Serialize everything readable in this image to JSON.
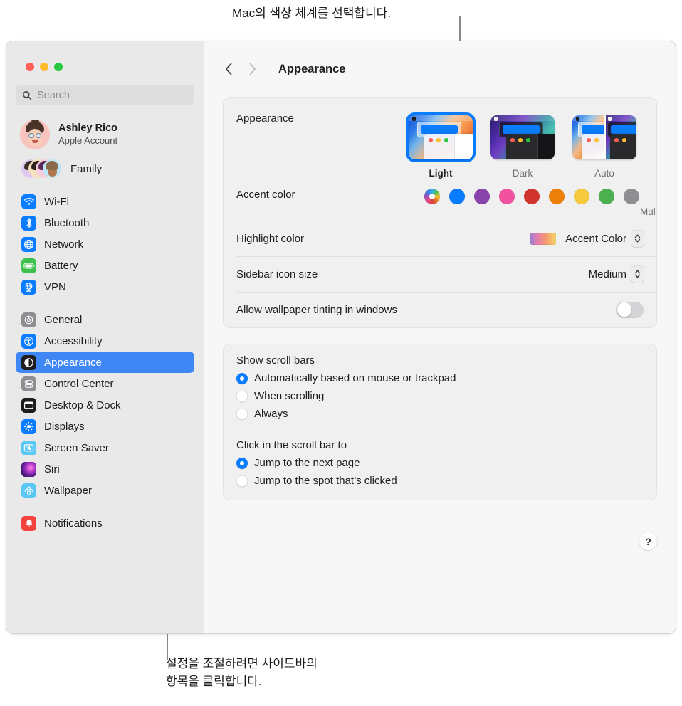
{
  "callouts": {
    "top": "Mac의 색상 체계를 선택합니다.",
    "bottom_line1": "설정을 조절하려면 사이드바의",
    "bottom_line2": "항목을 클릭합니다."
  },
  "window": {
    "traffic_lights": [
      "close-red",
      "minimize-yellow",
      "zoom-green"
    ],
    "toolbar": {
      "back_icon": "chevron-left-icon",
      "forward_icon": "chevron-right-icon",
      "title": "Appearance"
    }
  },
  "sidebar": {
    "search": {
      "placeholder": "Search",
      "value": "",
      "icon": "search-icon"
    },
    "account": {
      "name": "Ashley Rico",
      "subtitle": "Apple Account",
      "avatar": "memoji-avatar"
    },
    "family": {
      "label": "Family",
      "avatars": 4
    },
    "groups": [
      {
        "items": [
          {
            "label": "Wi-Fi",
            "icon": "wifi-icon",
            "color": "#0a7cff",
            "selected": false
          },
          {
            "label": "Bluetooth",
            "icon": "bluetooth-icon",
            "color": "#0a7cff",
            "selected": false
          },
          {
            "label": "Network",
            "icon": "globe-icon",
            "color": "#0a7cff",
            "selected": false
          },
          {
            "label": "Battery",
            "icon": "battery-icon",
            "color": "#3ec04e",
            "selected": false
          },
          {
            "label": "VPN",
            "icon": "vpn-globe-icon",
            "color": "#0a7cff",
            "selected": false
          }
        ]
      },
      {
        "items": [
          {
            "label": "General",
            "icon": "gear-icon",
            "color": "#8e8e93",
            "selected": false
          },
          {
            "label": "Accessibility",
            "icon": "accessibility-icon",
            "color": "#0a7cff",
            "selected": false
          },
          {
            "label": "Appearance",
            "icon": "appearance-contrast-icon",
            "color": "#1d1d1f",
            "selected": true
          },
          {
            "label": "Control Center",
            "icon": "control-center-icon",
            "color": "#8e8e93",
            "selected": false
          },
          {
            "label": "Desktop & Dock",
            "icon": "desktop-dock-icon",
            "color": "#1d1d1f",
            "selected": false
          },
          {
            "label": "Displays",
            "icon": "brightness-icon",
            "color": "#0a7cff",
            "selected": false
          },
          {
            "label": "Screen Saver",
            "icon": "screensaver-icon",
            "color": "#5ac8f5",
            "selected": false
          },
          {
            "label": "Siri",
            "icon": "siri-icon",
            "color": "#2a1040",
            "selected": false
          },
          {
            "label": "Wallpaper",
            "icon": "wallpaper-flower-icon",
            "color": "#5ac8f5",
            "selected": false
          }
        ]
      },
      {
        "items": [
          {
            "label": "Notifications",
            "icon": "bell-icon",
            "color": "#f4433c",
            "selected": false
          }
        ]
      }
    ]
  },
  "main": {
    "appearance": {
      "label": "Appearance",
      "options": [
        {
          "label": "Light",
          "selected": true
        },
        {
          "label": "Dark",
          "selected": false
        },
        {
          "label": "Auto",
          "selected": false
        }
      ]
    },
    "accent_color": {
      "label": "Accent color",
      "selected_name": "Multicolor",
      "swatches": [
        {
          "name": "Multicolor",
          "color": "multicolor",
          "selected": true
        },
        {
          "name": "Blue",
          "color": "#0a7cff",
          "selected": false
        },
        {
          "name": "Purple",
          "color": "#8944ab",
          "selected": false
        },
        {
          "name": "Pink",
          "color": "#f2519f",
          "selected": false
        },
        {
          "name": "Red",
          "color": "#d0342c",
          "selected": false
        },
        {
          "name": "Orange",
          "color": "#ed8008",
          "selected": false
        },
        {
          "name": "Yellow",
          "color": "#f7c93e",
          "selected": false
        },
        {
          "name": "Green",
          "color": "#4cb050",
          "selected": false
        },
        {
          "name": "Graphite",
          "color": "#8e8e93",
          "selected": false
        }
      ]
    },
    "highlight_color": {
      "label": "Highlight color",
      "value": "Accent Color",
      "swatch": "accent-gradient"
    },
    "sidebar_icon_size": {
      "label": "Sidebar icon size",
      "value": "Medium"
    },
    "wallpaper_tinting": {
      "label": "Allow wallpaper tinting in windows",
      "enabled": false
    },
    "show_scroll_bars": {
      "title": "Show scroll bars",
      "options": [
        {
          "label": "Automatically based on mouse or trackpad",
          "selected": true
        },
        {
          "label": "When scrolling",
          "selected": false
        },
        {
          "label": "Always",
          "selected": false
        }
      ]
    },
    "click_scroll_bar": {
      "title": "Click in the scroll bar to",
      "options": [
        {
          "label": "Jump to the next page",
          "selected": true
        },
        {
          "label": "Jump to the spot that’s clicked",
          "selected": false
        }
      ]
    },
    "help_button": "?"
  }
}
